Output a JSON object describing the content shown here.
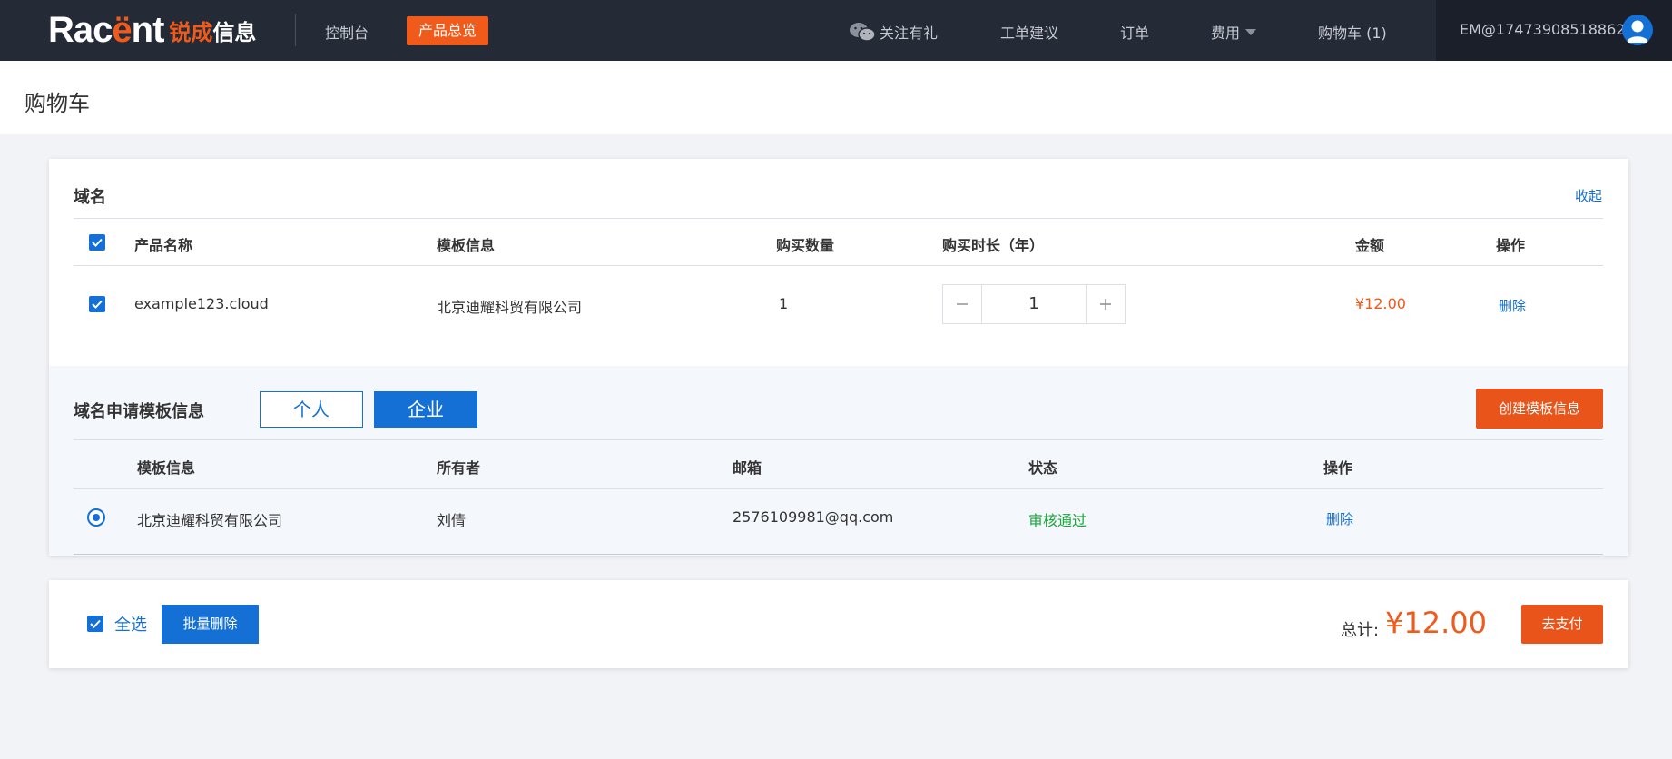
{
  "topbar": {
    "logo_en_prefix": "Rac",
    "logo_en_accent": "ë",
    "logo_en_suffix": "nt",
    "logo_cn_accent": "锐成",
    "logo_cn_rest": "信息",
    "console": "控制台",
    "overview": "产品总览",
    "follow": "关注有礼",
    "ticket": "工单建议",
    "orders": "订单",
    "fees": "费用",
    "cart": "购物车 (1)",
    "user": "EM@17473908518862"
  },
  "page": {
    "title": "购物车"
  },
  "domain_section": {
    "title": "域名",
    "collapse": "收起",
    "headers": {
      "product": "产品名称",
      "template": "模板信息",
      "quantity": "购买数量",
      "duration": "购买时长（年）",
      "amount": "金额",
      "action": "操作"
    },
    "row": {
      "product": "example123.cloud",
      "template": "北京迪耀科贸有限公司",
      "quantity": "1",
      "duration": "1",
      "amount": "¥12.00",
      "action": "删除"
    }
  },
  "template_section": {
    "title": "域名申请模板信息",
    "personal": "个人",
    "company": "企业",
    "create": "创建模板信息",
    "headers": {
      "template": "模板信息",
      "owner": "所有者",
      "email": "邮箱",
      "status": "状态",
      "action": "操作"
    },
    "row": {
      "template": "北京迪耀科贸有限公司",
      "owner": "刘倩",
      "email": "2576109981@qq.com",
      "status": "审核通过",
      "action": "删除"
    }
  },
  "footer": {
    "select_all": "全选",
    "batch_delete": "批量删除",
    "total_label": "总计:",
    "total_value": "¥12.00",
    "pay": "去支付"
  },
  "colors": {
    "nav_bg": "#252a37",
    "accent_orange": "#f05a1a",
    "primary_blue": "#1570d6",
    "success_green": "#19a63a"
  }
}
